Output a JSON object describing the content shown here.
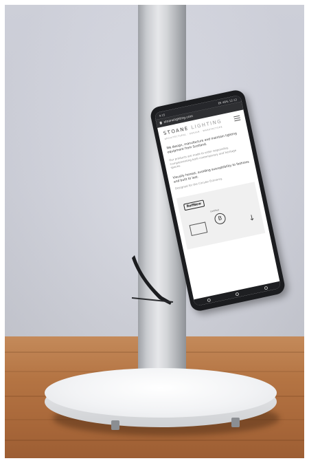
{
  "phone": {
    "status_left": "4:15",
    "status_right": "EE 48% 12:12",
    "url": "stoanelighting.com",
    "brand_dark": "STOANE",
    "brand_light": "LIGHTING",
    "tagline": "ARCHITECTURAL · DESIGN · MANUFACTURE",
    "p1": "We design, manufacture and maintain lighting equipment from Scotland.",
    "p2": "Our products are made to order responsibly. Complementing both contemporary and heritage spaces.",
    "p3": "Visually honest, avoiding susceptibility to fashions and built to last.",
    "p4": "Designed for the Circular Economy.",
    "logo_refnew": "RefNew",
    "bcorp_label": "Certified",
    "bcorp_letter": "B",
    "arrow": "↓"
  },
  "colors": {
    "wall": "#d2d4de",
    "table": "#b47443",
    "pole": "#d3d5d8",
    "base": "#f2f3f5",
    "phone_body": "#1b1c1f"
  }
}
